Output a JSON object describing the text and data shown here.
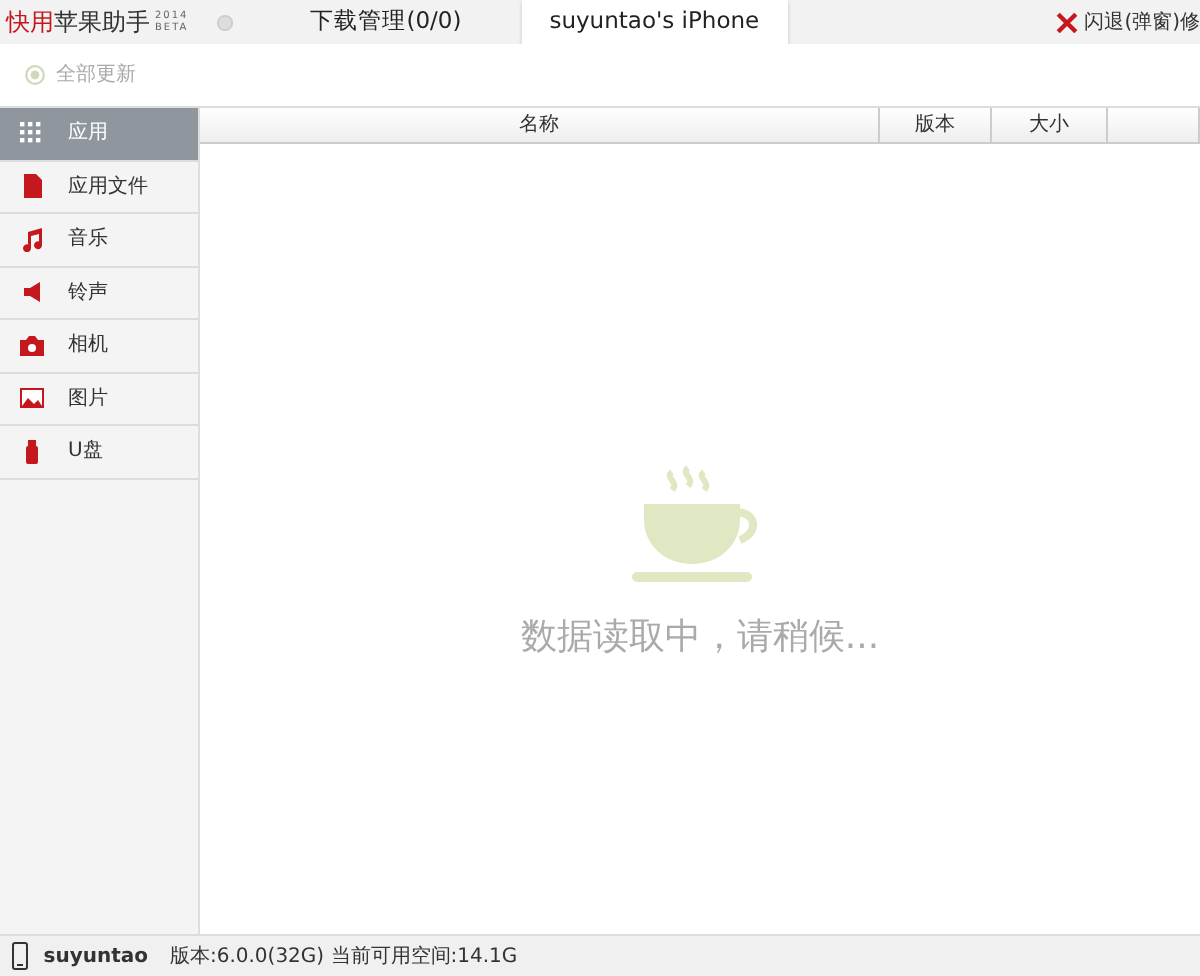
{
  "app": {
    "brand_highlight": "快用",
    "brand_rest": "苹果助手",
    "edition_year": "2014",
    "edition_tag": "BETA"
  },
  "tabs": [
    {
      "label": "下载管理(0/0)",
      "selected": false
    },
    {
      "label": "suyuntao's iPhone",
      "selected": true
    }
  ],
  "repair_button": {
    "label": "闪退(弹窗)修"
  },
  "toolbar": {
    "update_all": {
      "label": "全部更新",
      "disabled": true
    }
  },
  "sidebar": {
    "items": [
      {
        "label": "应用",
        "selected": true
      },
      {
        "label": "应用文件",
        "selected": false
      },
      {
        "label": "音乐",
        "selected": false
      },
      {
        "label": "铃声",
        "selected": false
      },
      {
        "label": "相机",
        "selected": false
      },
      {
        "label": "图片",
        "selected": false
      },
      {
        "label": "U盘",
        "selected": false
      }
    ]
  },
  "table": {
    "columns": [
      "名称",
      "版本",
      "大小"
    ]
  },
  "loading": {
    "message": "数据读取中，请稍候..."
  },
  "status_bar": {
    "device": "suyuntao",
    "info": "版本:6.0.0(32G) 当前可用空间:14.1G"
  }
}
